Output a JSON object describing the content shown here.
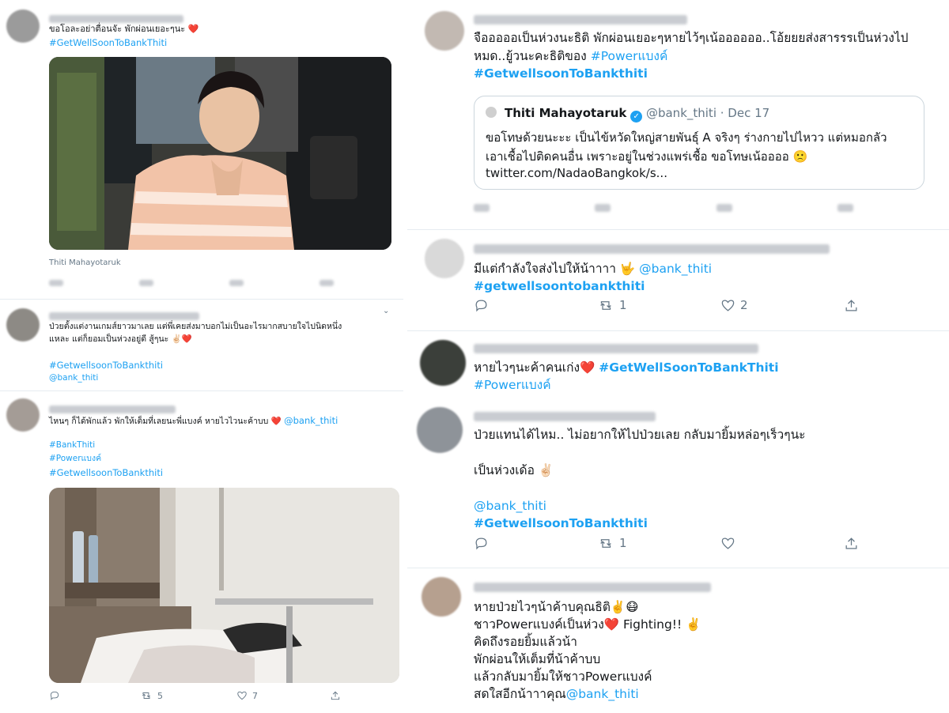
{
  "left": {
    "tweet1": {
      "text": "ขอโอละอย่าตื่อนจัะ พักผ่อนเยอะๆนะ ❤️",
      "hashtag": "#GetWellSoonToBankThiti",
      "caption": "Thiti Mahayotaruk"
    },
    "tweet2": {
      "text_line1": "ป่วยตั้งแต่งานเกมส์ยาวมาเลย แต่พี่เคยส่งมาบอกไม่เป็นอะไรมากสบายใจไปนิดหนึ่ง",
      "text_line2": "แหละ แต่ก็ยอมเป็นห่วงอยู่ดี สู้ๆนะ ✌🏻❤️",
      "hashtag": "#GetwellsoonToBankthiti",
      "mention": "@bank_thiti"
    },
    "tweet3": {
      "text": "ไหนๆ ก็ได้พักแล้ว พักให้เต็มที่เลยนะพี่แบงค์ หายไวไวนะค้าบบ ❤️",
      "mention": "@bank_thiti",
      "hashtag1": "#BankThiti",
      "hashtag2": "#Powerแบงค์",
      "hashtag3": "#GetwellsoonToBankthiti",
      "retweets": "5",
      "likes": "7"
    }
  },
  "right": {
    "tweet1": {
      "text_line1": "จือออออเป็นห่วงนะธิติ  พักผ่อนเยอะๆหายไว้ๆเน้ออออออ..โอ้ยยยส่งสารรรเป็นห่วงไป",
      "text_line2": "หมด..ยู้วนะคะธิติของ",
      "hashtag_inline": "#Powerแบงค์",
      "hashtag": "#GetwellsoonToBankthiti",
      "quote": {
        "name": "Thiti Mahayotaruk",
        "handle": "@bank_thiti",
        "date": "· Dec 17",
        "line1": "ขอโทษด้วยนะะะ เป็นไข้หวัดใหญ่สายพันธุ์ A จริงๆ ร่างกายไปไหวว แต่หมอกลัว",
        "line2": "เอาเชื้อไปติดคนอื่น เพราะอยู่ในช่วงแพร่เชื้อ ขอโทษเน้ออออ 🙁",
        "link": "twitter.com/NadaoBangkok/s..."
      }
    },
    "tweet2": {
      "text": "มีแต่กำลังใจส่งไปให้น้าาาา 🤟",
      "mention": "@bank_thiti",
      "hashtag": "#getwellsoontobankthiti",
      "retweets": "1",
      "likes": "2"
    },
    "tweet3": {
      "text": "หายไวๆนะค้าคนเก่ง❤️",
      "hashtag1": "#GetWellSoonToBankThiti",
      "hashtag2": "#Powerแบงค์"
    },
    "tweet4": {
      "text_line1": "ป่วยแทนได้ไหม.. ไม่อยากให้ไปป่วยเลย  กลับมายิ้มหล่อๆเร็วๆนะ",
      "text_line2": "เป็นห่วงเด้อ ✌🏻",
      "mention": "@bank_thiti",
      "hashtag": "#GetwellsoonToBankthiti",
      "retweets": "1"
    },
    "tweet5": {
      "line1": "หายป่วยไวๆน้าค้าบคุณธิติ✌️😷",
      "line2a": "ชาวPowerแบงค์เป็นห่วง❤️ Fighting!! ✌️",
      "line3": " คิดถึงรอยยิ้มแล้วน้า",
      "line4": "พักผ่อนให้เต็มที่น้าค้าบบ",
      "line5": "แล้วกลับมายิ้มให้ชาวPowerแบงค์",
      "line6": "สดใสอีกน้าาาคุณ",
      "mention": "@bank_thiti"
    }
  },
  "icons": {
    "reply": "reply-icon",
    "retweet": "retweet-icon",
    "like": "heart-icon",
    "share": "share-icon"
  },
  "colors": {
    "accent": "#1da1f2",
    "muted": "#657786",
    "heart": "#e0245e"
  }
}
